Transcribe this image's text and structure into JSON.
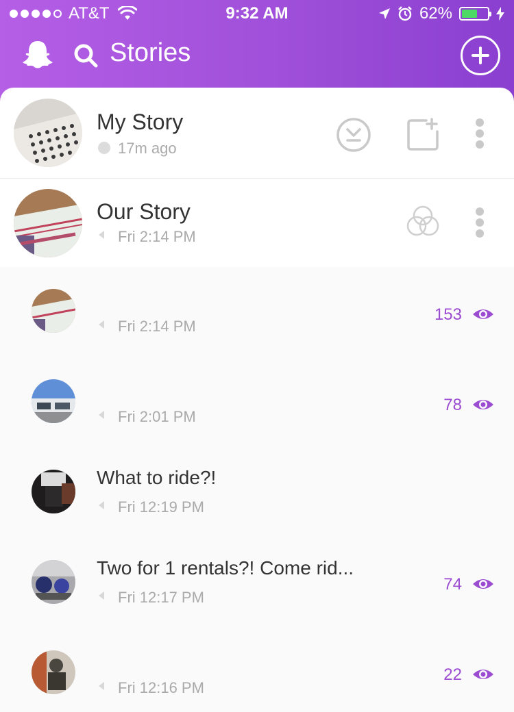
{
  "status_bar": {
    "carrier": "AT&T",
    "time": "9:32 AM",
    "battery": "62%",
    "battery_level": 0.62
  },
  "header": {
    "title": "Stories",
    "icons": [
      "ghost-icon",
      "search-icon",
      "add-icon"
    ]
  },
  "my_story": {
    "name": "My Story",
    "time": "17m ago",
    "actions": [
      "save-story-icon",
      "add-to-story-icon",
      "more-icon"
    ]
  },
  "our_story": {
    "name": "Our Story",
    "time": "Fri 2:14 PM",
    "actions": [
      "our-story-icon",
      "more-icon"
    ]
  },
  "snaps": [
    {
      "title": "",
      "time": "Fri 2:14 PM",
      "views": "153"
    },
    {
      "title": "",
      "time": "Fri 2:01 PM",
      "views": "78"
    },
    {
      "title": "What to ride?!",
      "time": "Fri 12:19 PM",
      "views": ""
    },
    {
      "title": "Two for 1 rentals?! Come rid...",
      "time": "Fri 12:17 PM",
      "views": "74"
    },
    {
      "title": "",
      "time": "Fri 12:16 PM",
      "views": "22"
    }
  ],
  "colors": {
    "header_gradient_start": "#b55ee6",
    "header_gradient_end": "#8a3fd0",
    "accent": "#9b4cd1",
    "battery_green": "#4cd964"
  }
}
